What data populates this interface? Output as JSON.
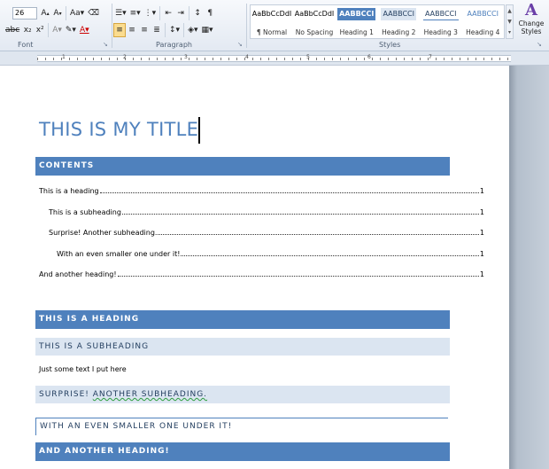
{
  "ribbon": {
    "font_size": "26",
    "groups": {
      "font": "Font",
      "paragraph": "Paragraph",
      "styles": "Styles"
    },
    "styles_gallery": [
      {
        "preview": "AaBbCcDdI",
        "name": "¶ Normal",
        "preview_color": "#000000",
        "bg": "#ffffff",
        "selected": false
      },
      {
        "preview": "AaBbCcDdI",
        "name": "No Spacing",
        "preview_color": "#000000",
        "bg": "#ffffff",
        "selected": false
      },
      {
        "preview": "AABBCCI",
        "name": "Heading 1",
        "preview_color": "#ffffff",
        "bg": "#4f81bd",
        "selected": true
      },
      {
        "preview": "AABBCCI",
        "name": "Heading 2",
        "preview_color": "#243f60",
        "bg": "#dbe5f1",
        "selected": false
      },
      {
        "preview": "AABBCCI",
        "name": "Heading 3",
        "preview_color": "#243f60",
        "bg": "#ffffff",
        "selected": false
      },
      {
        "preview": "AABBCCI",
        "name": "Heading 4",
        "preview_color": "#4f81bd",
        "bg": "#ffffff",
        "selected": false
      }
    ],
    "change_styles": {
      "label_line1": "Change",
      "label_line2": "Styles"
    }
  },
  "ruler": {
    "numbers": [
      "1",
      "2",
      "3",
      "4",
      "5",
      "6",
      "7"
    ]
  },
  "document": {
    "title": "THIS IS MY TITLE",
    "contents_heading": "CONTENTS",
    "toc": [
      {
        "label": "This is a heading",
        "page": "1",
        "level": 1
      },
      {
        "label": "This is a subheading",
        "page": "1",
        "level": 2
      },
      {
        "label": "Surprise! Another subheading.",
        "page": "1",
        "level": 2
      },
      {
        "label": "With an even smaller one under it!",
        "page": "1",
        "level": 3
      },
      {
        "label": "And another heading!",
        "page": "1",
        "level": 1
      }
    ],
    "heading1": "THIS IS A HEADING",
    "subheading1": "THIS IS A SUBHEADING",
    "body_text": "Just some text I put here",
    "subheading2_prefix": "SURPRISE! ",
    "subheading2_underlined": "ANOTHER SUBHEADING.",
    "heading3": "WITH AN EVEN SMALLER ONE UNDER IT!",
    "heading2": "AND ANOTHER HEADING!"
  },
  "colors": {
    "accent": "#4f81bd",
    "light_accent": "#dbe5f1",
    "dark_text": "#243f60"
  }
}
